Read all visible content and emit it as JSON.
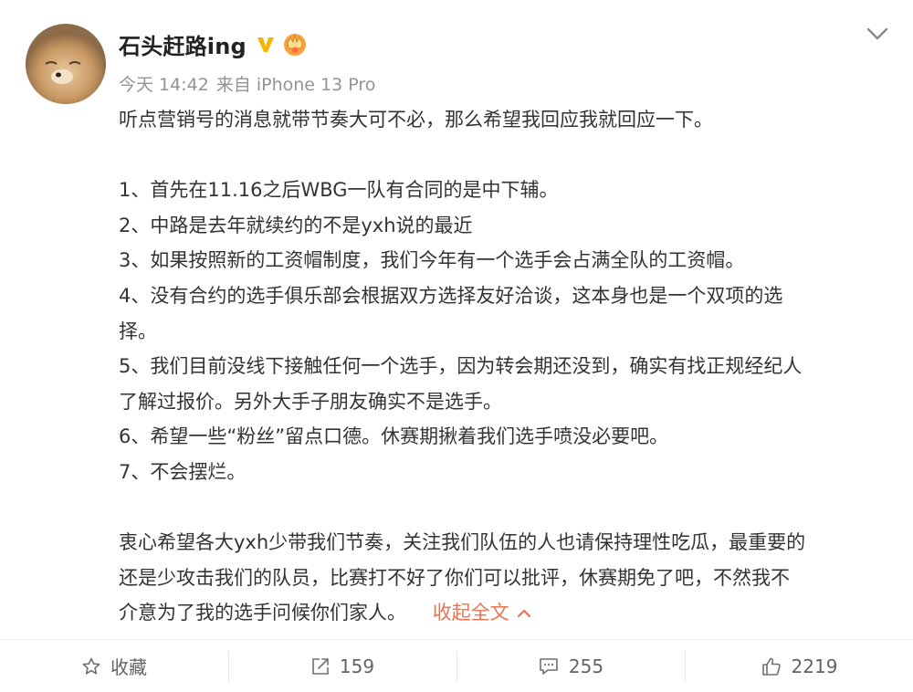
{
  "header": {
    "username": "石头赶路ing",
    "timestamp": "今天 14:42",
    "source": "来自 iPhone 13 Pro",
    "verified_badge_color": "#f7b500",
    "icons": [
      "avatar",
      "verified-icon",
      "crown-icon",
      "chevron-down-icon"
    ]
  },
  "content": {
    "lines": [
      "听点营销号的消息就带节奏大可不必，那么希望我回应我就回应一下。",
      "",
      "1、首先在11.16之后WBG一队有合同的是中下辅。",
      "2、中路是去年就续约的不是yxh说的最近",
      "3、如果按照新的工资帽制度，我们今年有一个选手会占满全队的工资帽。",
      "4、没有合约的选手俱乐部会根据双方选择友好洽谈，这本身也是一个双项的选",
      "择。",
      "5、我们目前没线下接触任何一个选手，因为转会期还没到，确实有找正规经纪人",
      "了解过报价。另外大手子朋友确实不是选手。",
      "6、希望一些“粉丝”留点口德。休赛期揪着我们选手喷没必要吧。",
      "7、不会摆烂。",
      "",
      "衷心希望各大yxh少带我们节奏，关注我们队伍的人也请保持理性吃瓜，最重要的",
      "还是少攻击我们的队员，比赛打不好了你们可以批评，休赛期免了吧，不然我不",
      "介意为了我的选手问候你们家人。"
    ],
    "collapse_label": "收起全文",
    "link_color": "#eb7350"
  },
  "actions": {
    "favorite_label": "收藏",
    "repost_count": "159",
    "comment_count": "255",
    "like_count": "2219"
  }
}
